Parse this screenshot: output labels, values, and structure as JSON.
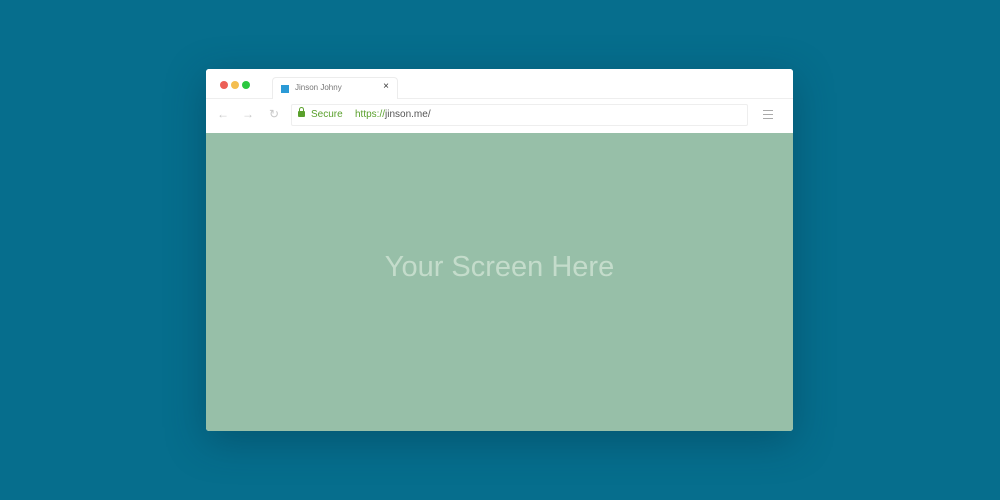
{
  "tab": {
    "title": "Jinson Johny",
    "close": "×"
  },
  "toolbar": {
    "back": "←",
    "forward": "→",
    "reload": "↻",
    "secure_label": "Secure",
    "url_scheme": "https://",
    "url_rest": "jinson.me/"
  },
  "content": {
    "placeholder": "Your Screen Here"
  },
  "colors": {
    "background": "#066e8d",
    "content": "#97bfa8",
    "secure": "#5aa02c",
    "close": "#ec5f57",
    "minimize": "#f4be4f",
    "maximize": "#2bc840"
  }
}
